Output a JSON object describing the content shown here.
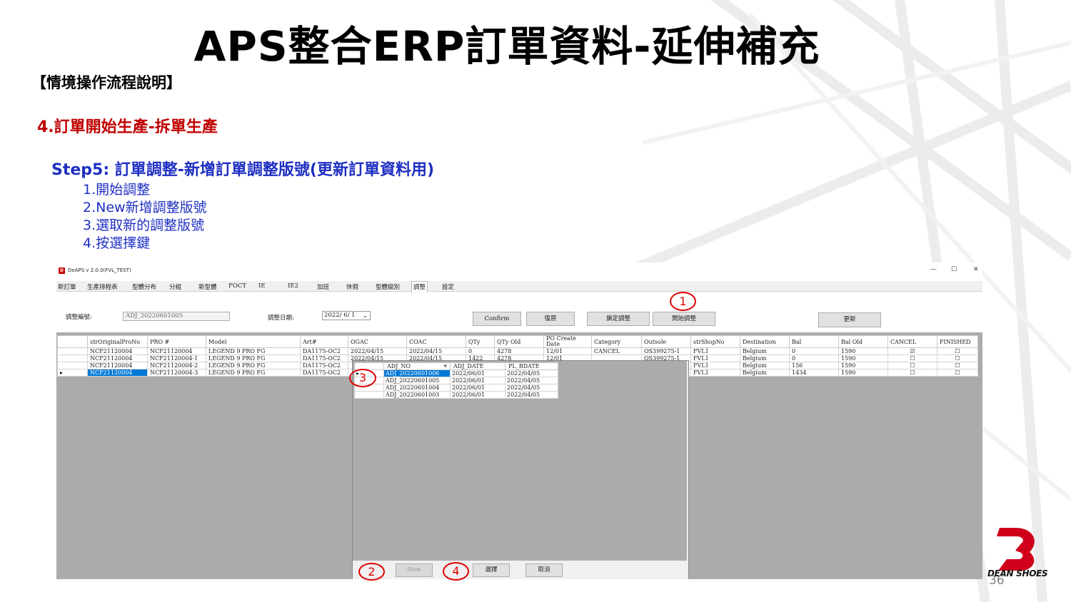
{
  "slide": {
    "title": "APS整合ERP訂單資料-延伸補充",
    "subtitle": "【情境操作流程說明】",
    "section": "4.訂單開始生產-拆單生產",
    "step_heading": "Step5: 訂單調整-新增訂單調整版號(更新訂單資料用)",
    "steps": [
      "1.開始調整",
      "2.New新增調整版號",
      "3.選取新的調整版號",
      "4.按選擇鍵"
    ],
    "page_number": "36",
    "logo_text": "DEAN SHOES"
  },
  "app": {
    "window_title": "DeAPS v 2.0.0(FVL_TEST)",
    "app_icon": "D",
    "win_controls": {
      "minimize": "—",
      "maximize": "☐",
      "close": "✕"
    },
    "menu": [
      "新訂單",
      "生產排程表",
      "型體分布",
      "分組",
      "新型體",
      "FOCT",
      "IE",
      "IE2",
      "加班",
      "休假",
      "型體級別",
      "調整",
      "設定"
    ],
    "form": {
      "adj_no_label": "調整編號:",
      "adj_no_value": "ADJ_20220601005",
      "adj_date_label": "調整日期:",
      "adj_date_value": "2022/ 6/ 1",
      "buttons": {
        "confirm": "Confirm",
        "restore": "復原",
        "lock": "鎖定調整",
        "start": "開始調整",
        "update": "更新"
      }
    },
    "grid": {
      "columns": [
        "strOriginalProNo",
        "PRO #",
        "Model",
        "Art#",
        "OGAC",
        "COAC",
        "QTy",
        "QTy Old",
        "PO Create Date",
        "Category",
        "Outsole",
        "strShopNo",
        "Destination",
        "Bal",
        "Bal Old",
        "CANCEL",
        "FINISHED"
      ],
      "rows": [
        {
          "marker": "",
          "orig": "NCF21120004",
          "pro": "NCF21120004",
          "model": "LEGEND 9 PRO FG",
          "art": "DA1175-OC2",
          "ogac": "2022/04/15",
          "coac": "2022/04/15",
          "qty": "0",
          "qty_old": "4278",
          "po_date": "12/01",
          "category": "CANCEL",
          "outsole": "OS399275-1",
          "shop": "FVL1",
          "dest": "Belgium",
          "bal": "0",
          "bal_old": "1590",
          "cancel": "☑",
          "finished": "☐"
        },
        {
          "marker": "",
          "orig": "NCF21120004",
          "pro": "NCF21120004-1",
          "model": "LEGEND 9 PRO FG",
          "art": "DA1175-OC2",
          "ogac": "2022/04/15",
          "coac": "2022/04/15",
          "qty": "1422",
          "qty_old": "4278",
          "po_date": "12/01",
          "category": "",
          "outsole": "OS399275-1",
          "shop": "FVL1",
          "dest": "Belgium",
          "bal": "0",
          "bal_old": "1590",
          "cancel": "☐",
          "finished": "☐"
        },
        {
          "marker": "",
          "orig": "NCF21120004",
          "pro": "NCF21120004-2",
          "model": "LEGEND 9 PRO FG",
          "art": "DA1175-OC2",
          "ogac": "",
          "coac": "",
          "qty": "",
          "qty_old": "",
          "po_date": "",
          "category": "",
          "outsole": "",
          "shop": "FVL1",
          "dest": "Belgium",
          "bal": "156",
          "bal_old": "1590",
          "cancel": "☐",
          "finished": "☐"
        },
        {
          "marker": "▸",
          "orig": "NCF21120004",
          "pro": "NCF21120004-3",
          "model": "LEGEND 9 PRO FG",
          "art": "DA1175-OC2",
          "ogac": "",
          "coac": "",
          "qty": "",
          "qty_old": "",
          "po_date": "",
          "category": "",
          "outsole": "",
          "shop": "FVL1",
          "dest": "Belgium",
          "bal": "1434",
          "bal_old": "1590",
          "cancel": "☐",
          "finished": "☐"
        }
      ]
    },
    "popup": {
      "columns": [
        "ADJ_NO",
        "ADJ_DATE",
        "PL_BDATE"
      ],
      "rows": [
        {
          "marker": "▸",
          "adj_no": "ADJ_20220601006",
          "adj_date": "2022/06/01",
          "pl_bdate": "2022/04/05"
        },
        {
          "marker": "",
          "adj_no": "ADJ_20220601005",
          "adj_date": "2022/06/01",
          "pl_bdate": "2022/04/05"
        },
        {
          "marker": "",
          "adj_no": "ADJ_20220601004",
          "adj_date": "2022/06/01",
          "pl_bdate": "2022/04/05"
        },
        {
          "marker": "",
          "adj_no": "ADJ_20220601003",
          "adj_date": "2022/06/01",
          "pl_bdate": "2022/04/05"
        }
      ],
      "buttons": {
        "new": "New",
        "select": "選擇",
        "cancel": "取消"
      }
    }
  },
  "annotations": [
    "1",
    "2",
    "3",
    "4"
  ],
  "colors": {
    "section_red": "#c00000",
    "step_blue": "#1f2fc2",
    "annotation_red": "#e00000",
    "selection_blue": "#0078d7"
  }
}
